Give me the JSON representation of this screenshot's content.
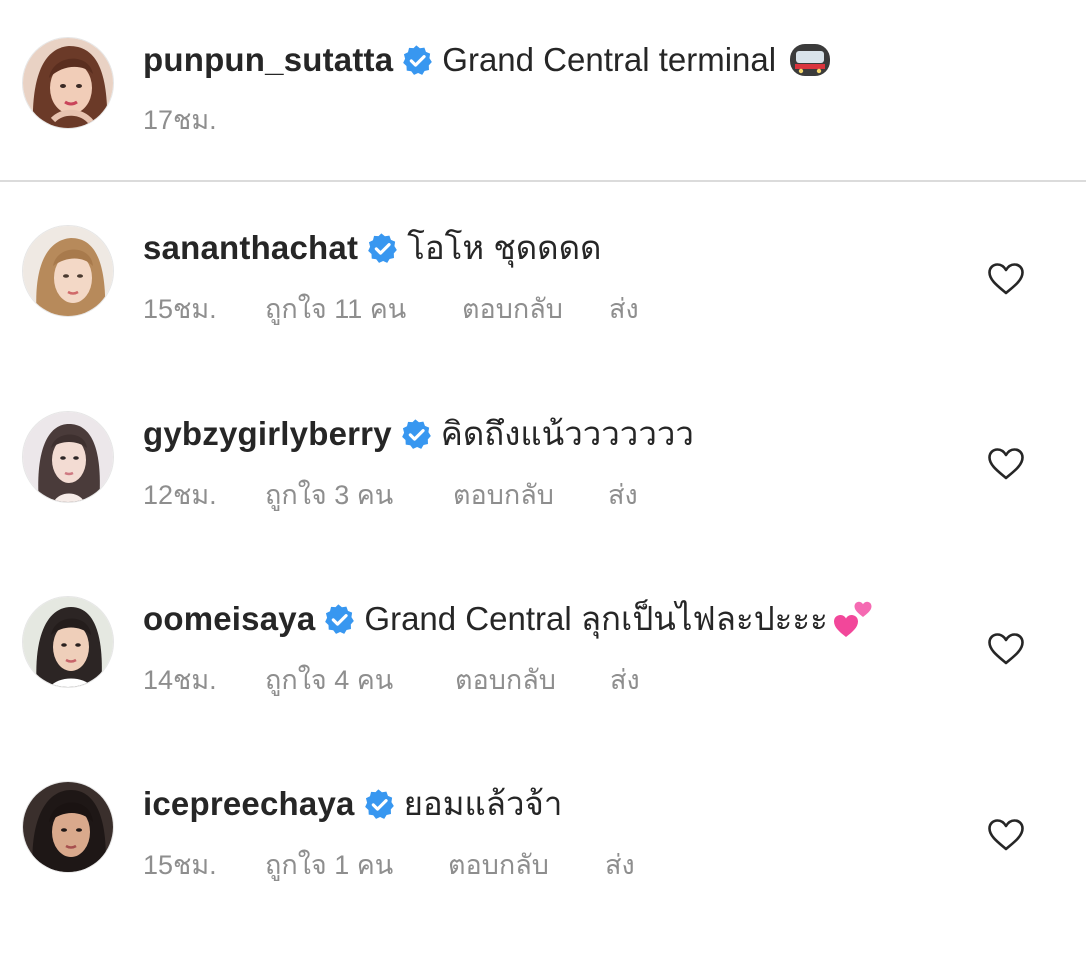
{
  "caption": {
    "username": "punpun_sutatta",
    "verified": true,
    "text": "Grand Central terminal",
    "emoji_icon": "metro-train-emoji",
    "time": "17ชม."
  },
  "comments": [
    {
      "username": "sananthachat",
      "verified": true,
      "text": "โอโห ชุดดดด",
      "time": "15ชม.",
      "likes": "ถูกใจ 11 คน",
      "reply_label": "ตอบกลับ",
      "send_label": "ส่ง",
      "like_icon": "heart-outline-icon"
    },
    {
      "username": "gybzygirlyberry",
      "verified": true,
      "text": "คิดถึงแน้ววววววว",
      "time": "12ชม.",
      "likes": "ถูกใจ 3 คน",
      "reply_label": "ตอบกลับ",
      "send_label": "ส่ง",
      "like_icon": "heart-outline-icon"
    },
    {
      "username": "oomeisaya",
      "verified": true,
      "text": "Grand Central ลุกเป็นไฟละปะะะ",
      "emoji_icon": "two-hearts-emoji",
      "time": "14ชม.",
      "likes": "ถูกใจ 4 คน",
      "reply_label": "ตอบกลับ",
      "send_label": "ส่ง",
      "like_icon": "heart-outline-icon"
    },
    {
      "username": "icepreechaya",
      "verified": true,
      "text": "ยอมแล้วจ้า",
      "time": "15ชม.",
      "likes": "ถูกใจ 1 คน",
      "reply_label": "ตอบกลับ",
      "send_label": "ส่ง",
      "like_icon": "heart-outline-icon"
    }
  ],
  "colors": {
    "text": "#262626",
    "secondary": "#8e8e8e",
    "verified_badge": "#3897f0",
    "divider": "#dbdbdb"
  }
}
